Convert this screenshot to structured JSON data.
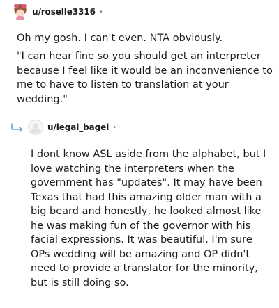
{
  "comments": [
    {
      "username": "u/roselle3316",
      "separator": "•",
      "paragraphs": [
        "Oh my gosh. I can't even. NTA obviously.",
        "\"I can hear fine so you should get an interpreter because I feel like it would be an inconvenience to me to have to listen to translation at your wedding.\""
      ]
    },
    {
      "username": "u/legal_bagel",
      "separator": "•",
      "paragraphs": [
        "I dont know ASL aside from the alphabet, but I love watching the interpreters when the government has \"updates\". It may have been Texas that had this amazing older man with a big beard and honestly, he looked almost like he was making fun of the governor with his facial expressions. It was beautiful. I'm sure OPs wedding will be amazing and OP didn't need to provide a translator for the minority, but is still doing so."
      ]
    }
  ],
  "colors": {
    "text": "#1c1c1c",
    "meta": "#878a8c",
    "reply_arrow": "#5fa8d3"
  },
  "icons": {
    "avatar_1": "custom-doll-avatar-icon",
    "avatar_2": "default-avatar-icon",
    "reply": "reply-arrow-icon"
  }
}
